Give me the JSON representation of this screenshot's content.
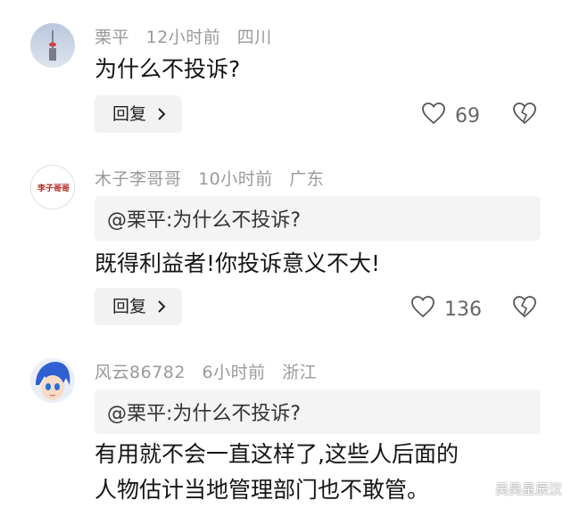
{
  "comments": [
    {
      "username": "栗平",
      "time": "12小时前",
      "location": "四川",
      "quote": "",
      "text_lines": [
        "为什么不投诉?"
      ],
      "reply_label": "回复",
      "likes": "69"
    },
    {
      "username": "木子李哥哥",
      "time": "10小时前",
      "location": "广东",
      "quote": "@栗平:为什么不投诉?",
      "text_lines": [
        "既得利益者!你投诉意义不大!"
      ],
      "reply_label": "回复",
      "likes": "136"
    },
    {
      "username": "风云86782",
      "time": "6小时前",
      "location": "浙江",
      "quote": "@栗平:为什么不投诉?",
      "text_lines": [
        "有用就不会一直这样了,这些人后面的",
        "人物估计当地管理部门也不敢管。"
      ],
      "reply_label": "",
      "likes": ""
    }
  ],
  "icons": {
    "like": "heart-outline-icon",
    "dislike": "broken-heart-icon",
    "chevron": "chevron-right-icon"
  },
  "watermark": "吴昊星辰汉",
  "colors": {
    "meta": "#9a9a9a",
    "quote_bg": "#f4f4f4",
    "button_bg": "#f2f2f2"
  }
}
